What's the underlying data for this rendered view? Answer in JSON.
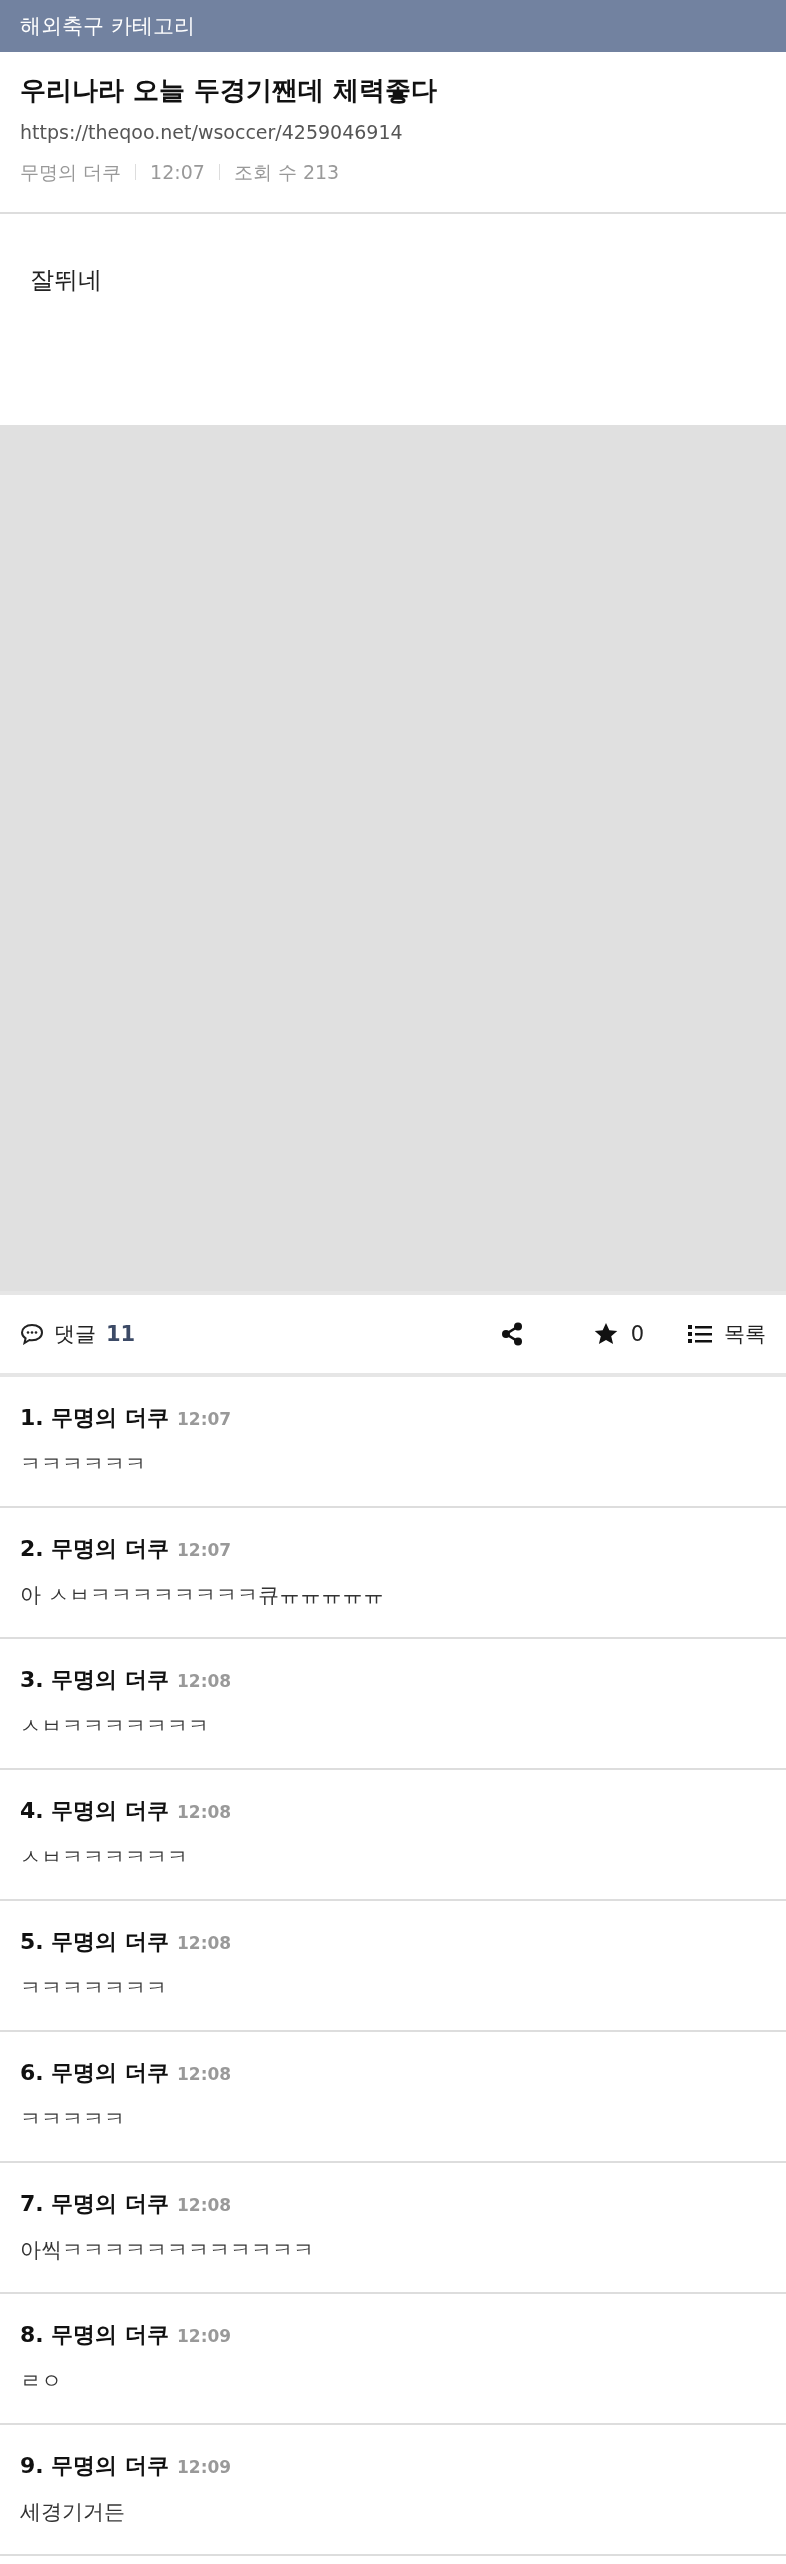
{
  "category_bar": {
    "title": "해외축구 카테고리"
  },
  "post": {
    "title": "우리나라 오늘 두경기짼데 체력좋다",
    "url": "https://theqoo.net/wsoccer/4259046914",
    "author": "무명의 더쿠",
    "time": "12:07",
    "views": "조회 수 213",
    "body": "잘뛰네"
  },
  "toolbar": {
    "comments_label": "댓글",
    "comments_count": "11",
    "star_count": "0",
    "list_label": "목록"
  },
  "comments": [
    {
      "heading": "1. 무명의 더쿠",
      "time": "12:07",
      "text": "ㅋㅋㅋㅋㅋㅋ"
    },
    {
      "heading": "2. 무명의 더쿠",
      "time": "12:07",
      "text": "아 ㅅㅂㅋㅋㅋㅋㅋㅋㅋㅋ큐ㅠㅠㅠㅠㅠ"
    },
    {
      "heading": "3. 무명의 더쿠",
      "time": "12:08",
      "text": "ㅅㅂㅋㅋㅋㅋㅋㅋㅋ"
    },
    {
      "heading": "4. 무명의 더쿠",
      "time": "12:08",
      "text": "ㅅㅂㅋㅋㅋㅋㅋㅋ"
    },
    {
      "heading": "5. 무명의 더쿠",
      "time": "12:08",
      "text": "ㅋㅋㅋㅋㅋㅋㅋ"
    },
    {
      "heading": "6. 무명의 더쿠",
      "time": "12:08",
      "text": "ㅋㅋㅋㅋㅋ"
    },
    {
      "heading": "7. 무명의 더쿠",
      "time": "12:08",
      "text": "아씩ㅋㅋㅋㅋㅋㅋㅋㅋㅋㅋㅋㅋ"
    },
    {
      "heading": "8. 무명의 더쿠",
      "time": "12:09",
      "text": "ㄹㅇ"
    },
    {
      "heading": "9. 무명의 더쿠",
      "time": "12:09",
      "text": "세경기거든"
    }
  ]
}
